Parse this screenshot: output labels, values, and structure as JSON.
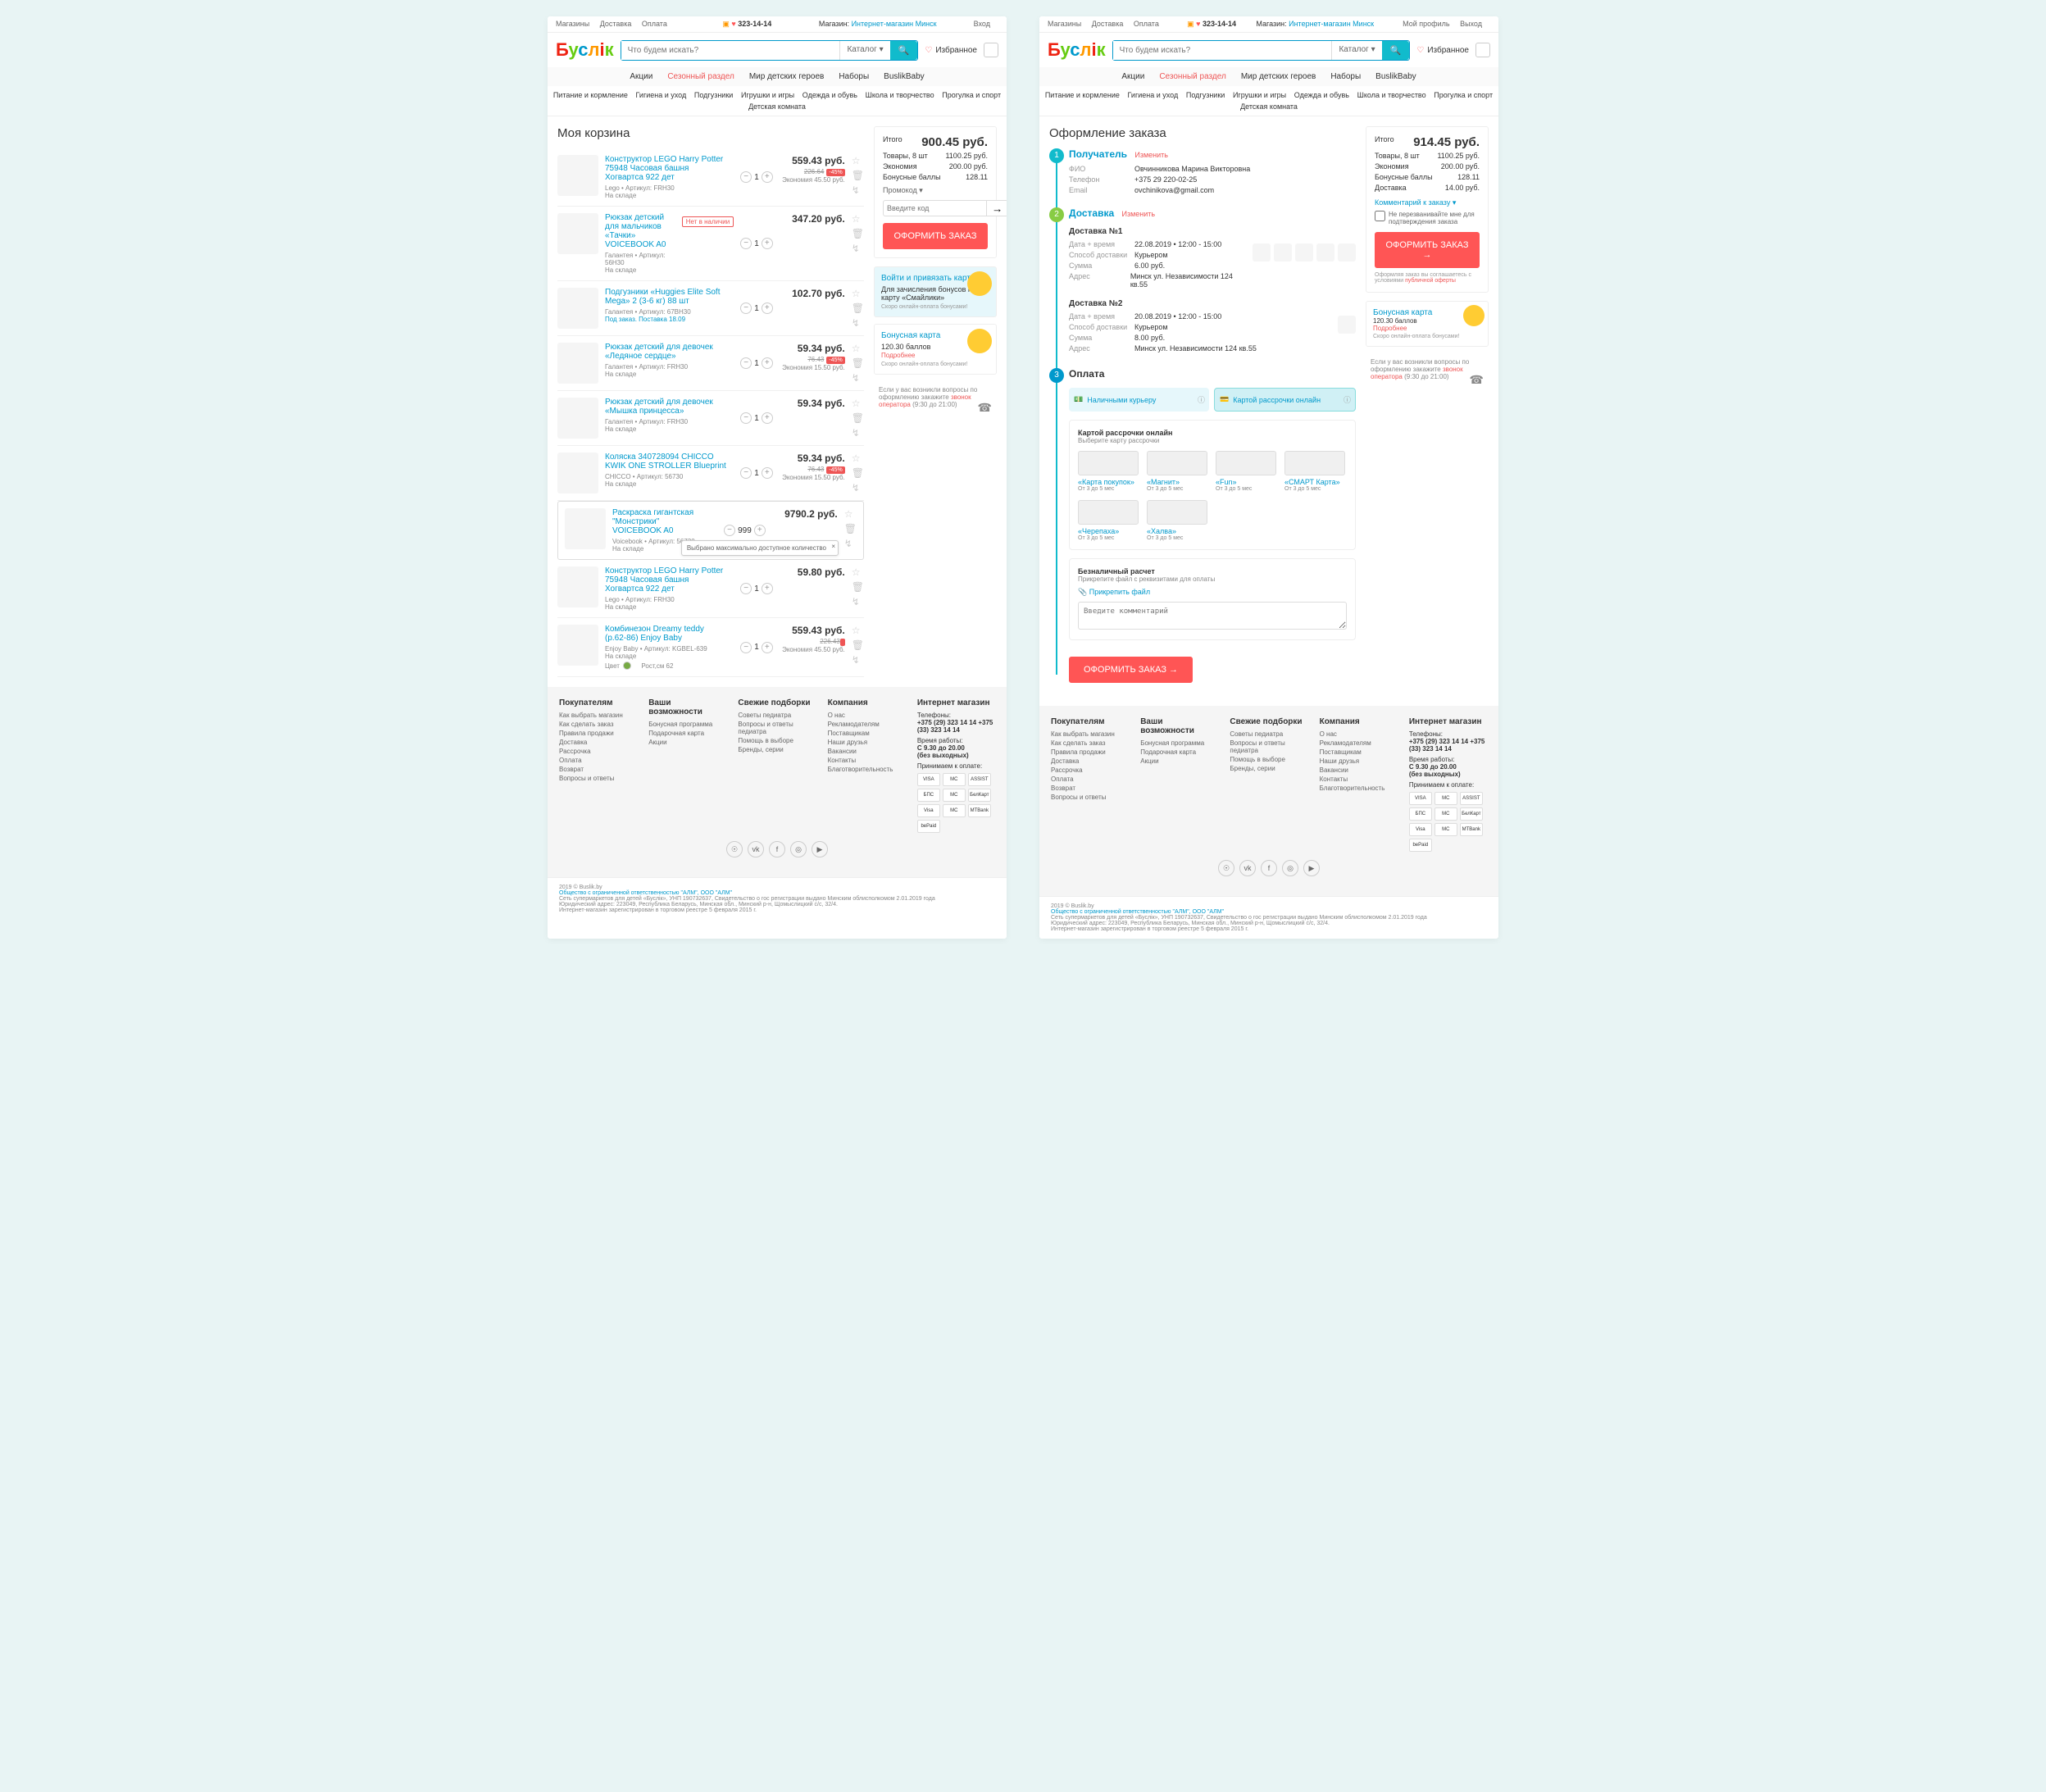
{
  "top": {
    "links": [
      "Магазины",
      "Доставка",
      "Оплата"
    ],
    "phone": "323-14-14",
    "store_label": "Магазин:",
    "store": "Интернет-магазин Минск",
    "login": "Вход",
    "profile": "Мой профиль",
    "logout": "Выход"
  },
  "search": {
    "placeholder": "Что будем искать?",
    "catalog": "Каталог",
    "favorites": "Избранное"
  },
  "mainnav": [
    "Акции",
    "Сезонный раздел",
    "Мир детских героев",
    "Наборы",
    "BuslikBaby"
  ],
  "subnav": [
    "Питание и кормление",
    "Гигиена и уход",
    "Подгузники",
    "Игрушки и игры",
    "Одежда и обувь",
    "Школа и творчество",
    "Прогулка и спорт",
    "Детская комната"
  ],
  "cart": {
    "title": "Моя корзина",
    "items": [
      {
        "name": "Конструктор LEGO Harry Potter 75948 Часовая башня Хогвартса 922 дет",
        "meta": "Lego • Артикул: FRH30",
        "stock": "На складе",
        "qty": "1",
        "price": "559.43 руб.",
        "old": "226.64",
        "disc": "-45%",
        "saving": "Экономия 45.50 руб."
      },
      {
        "name": "Рюкзак детский для мальчиков «Тачки» VOICEBOOK A0",
        "meta": "Галантея • Артикул: 56H30",
        "stock": "На складе",
        "out": "Нет в наличии",
        "qty": "1",
        "price": "347.20 руб."
      },
      {
        "name": "Подгузники «Huggies Elite Soft Mega» 2 (3-6 кг) 88 шт",
        "meta": "Галантея • Артикул: 67BH30",
        "stock": "Под заказ. Поставка 18.09",
        "pre": true,
        "qty": "1",
        "price": "102.70 руб."
      },
      {
        "name": "Рюкзак детский для девочек «Ледяное сердце»",
        "meta": "Галантея • Артикул: FRH30",
        "stock": "На складе",
        "qty": "1",
        "price": "59.34 руб.",
        "old": "76.43",
        "disc": "-45%",
        "saving": "Экономия 15.50 руб."
      },
      {
        "name": "Рюкзак детский для девочек «Мышка принцесса»",
        "meta": "Галантея • Артикул: FRH30",
        "stock": "На складе",
        "qty": "1",
        "price": "59.34 руб."
      },
      {
        "name": "Коляска 340728094 CHICCO KWIK ONE STROLLER Blueprint",
        "meta": "CHICCO • Артикул: 56730",
        "stock": "На складе",
        "qty": "1",
        "price": "59.34 руб.",
        "old": "76.43",
        "disc": "-45%",
        "saving": "Экономия 15.50 руб."
      },
      {
        "name": "Раскраска гигантская \"Монстрики\" VOICEBOOK A0",
        "meta": "Voicebook • Артикул: 56730",
        "stock": "На складе",
        "qty": "999",
        "price": "9790.2 руб.",
        "boxed": true,
        "maxwarn": true
      },
      {
        "name": "Конструктор LEGO Harry Potter 75948 Часовая башня Хогвартса 922 дет",
        "meta": "Lego • Артикул: FRH30",
        "stock": "На складе",
        "qty": "1",
        "price": "59.80 руб."
      },
      {
        "name": "Комбинезон Dreamy teddy (p.62-86) Enjoy Baby",
        "meta": "Enjoy Baby • Артикул: KGBEL-639",
        "stock": "На складе",
        "qty": "1",
        "price": "559.43 руб.",
        "old": "226.43",
        "saving": "Экономия 45.50 руб.",
        "color": "Цвет",
        "size": "Рост,см 62"
      }
    ],
    "maxwarn_text": "Выбрано максимально доступное количество"
  },
  "summary1": {
    "total_label": "Итого",
    "total": "900.45 руб.",
    "rows": [
      {
        "label": "Товары, 8 шт",
        "val": "1100.25 руб."
      },
      {
        "label": "Экономия",
        "val": "200.00 руб."
      },
      {
        "label": "Бонусные баллы",
        "val": "128.11"
      }
    ],
    "promo_label": "Промокод",
    "promo_placeholder": "Введите код",
    "btn": "ОФОРМИТЬ ЗАКАЗ"
  },
  "bonus1": {
    "title": "Войти и привязать карту",
    "text": "Для зачисления бонусов на карту «Смайлики»",
    "sub": "Скоро онлайн-оплата бонусами!"
  },
  "bonus2": {
    "title": "Бонусная карта",
    "points": "120.30 баллов",
    "link": "Подробнее",
    "sub": "Скоро онлайн-оплата бонусами!"
  },
  "help": {
    "text": "Если у вас возникли вопросы по оформлению закажите",
    "link": "звонок оператора",
    "hours": "(9:30 до 21:00)"
  },
  "checkout": {
    "title": "Оформление заказа",
    "edit": "Изменить",
    "step1": {
      "title": "Получатель",
      "name_label": "ФИО",
      "name": "Овчинникова Марина Викторовна",
      "phone_label": "Телефон",
      "phone": "+375 29 220-02-25",
      "email_label": "Email",
      "email": "ovchinikova@gmail.com"
    },
    "step2": {
      "title": "Доставка",
      "deliveries": [
        {
          "head": "Доставка №1",
          "dt_label": "Дата + время",
          "dt": "22.08.2019 • 12:00 - 15:00",
          "method_label": "Способ доставки",
          "method": "Курьером",
          "sum_label": "Сумма",
          "sum": "6.00 руб.",
          "addr_label": "Адрес",
          "addr": "Минск ул. Независимости 124 кв.55"
        },
        {
          "head": "Доставка №2",
          "dt_label": "Дата + время",
          "dt": "20.08.2019 • 12:00 - 15:00",
          "method_label": "Способ доставки",
          "method": "Курьером",
          "sum_label": "Сумма",
          "sum": "8.00 руб.",
          "addr_label": "Адрес",
          "addr": "Минск ул. Независимости 124 кв.55"
        }
      ]
    },
    "step3": {
      "title": "Оплата",
      "tabs": [
        "Наличными курьеру",
        "Картой рассрочки онлайн"
      ],
      "cards_title": "Картой рассрочки онлайн",
      "cards_sub": "Выберите карту рассрочки",
      "cards": [
        {
          "name": "«Карта покупок»",
          "sub": "От 3 до 5 мес"
        },
        {
          "name": "«Магнит»",
          "sub": "От 3 до 5 мес"
        },
        {
          "name": "«Fun»",
          "sub": "От 3 до 5 мес"
        },
        {
          "name": "«СМАРТ Карта»",
          "sub": "От 3 до 5 мес"
        },
        {
          "name": "«Черепаха»",
          "sub": "От 3 до 5 мес"
        },
        {
          "name": "«Халва»",
          "sub": "От 3 до 5 мес"
        }
      ],
      "cashless_title": "Безналичный расчет",
      "cashless_sub": "Прикрепите файл с реквизитами для оплаты",
      "attach": "Прикрепить файл",
      "comment_placeholder": "Введите комментарий",
      "submit": "ОФОРМИТЬ ЗАКАЗ  →"
    }
  },
  "summary2": {
    "total_label": "Итого",
    "total": "914.45 руб.",
    "rows": [
      {
        "label": "Товары, 8 шт",
        "val": "1100.25 руб."
      },
      {
        "label": "Экономия",
        "val": "200.00 руб."
      },
      {
        "label": "Бонусные баллы",
        "val": "128.11"
      },
      {
        "label": "Доставка",
        "val": "14.00 руб."
      }
    ],
    "comment_link": "Комментарий к заказу",
    "dont_call": "Не перезванивайте мне для подтверждения заказа",
    "btn": "ОФОРМИТЬ ЗАКАЗ  →",
    "agree": "Оформляя заказ вы соглашаетесь с условиями",
    "agree_link": "публичной оферты"
  },
  "footer": {
    "cols": [
      {
        "title": "Покупателям",
        "links": [
          "Как выбрать магазин",
          "Как сделать заказ",
          "Правила продажи",
          "Доставка",
          "Рассрочка",
          "Оплата",
          "Возврат",
          "Вопросы и ответы"
        ]
      },
      {
        "title": "Ваши возможности",
        "links": [
          "Бонусная программа",
          "Подарочная карта",
          "Акции"
        ]
      },
      {
        "title": "Свежие подборки",
        "links": [
          "Советы педиатра",
          "Вопросы и ответы педиатра",
          "Помощь в выборе",
          "Бренды, серии"
        ]
      },
      {
        "title": "Компания",
        "links": [
          "О нас",
          "Рекламодателям",
          "Поставщикам",
          "Наши друзья",
          "Вакансии",
          "Контакты",
          "Благотворительность"
        ]
      }
    ],
    "shop_title": "Интернет магазин",
    "phones_label": "Телефоны:",
    "phones": "+375 (29) 323 14 14 +375 (33) 323 14 14",
    "hours_label": "Время работы:",
    "hours": "С 9.30 до 20.00",
    "hours2": "(без выходных)",
    "pay_label": "Принимаем к оплате:",
    "paylogos": [
      "VISA",
      "MC",
      "ASSIST",
      "БПС",
      "MC",
      "БелКарт",
      "Visa",
      "MC",
      "MTBank",
      "bePaid"
    ],
    "copyright": "2019 © Buslik.by",
    "legal_link": "Общество с ограниченной ответственностью \"АЛМ\", ООО \"АЛМ\"",
    "legal1": "Сеть супермаркетов для детей «Буслiк», УНП 190732637, Свидетельство о гос регистрации выдано Минским облисполкомом 2.01.2019 года",
    "legal2": "Юридический адрес: 223049, Республика Беларусь, Минская обл., Минский р-н, Щомыслицкий с/с, 32/4.",
    "legal3": "Интернет-магазин зарегистрирован в торговом реестре 5 февраля 2015 г."
  }
}
